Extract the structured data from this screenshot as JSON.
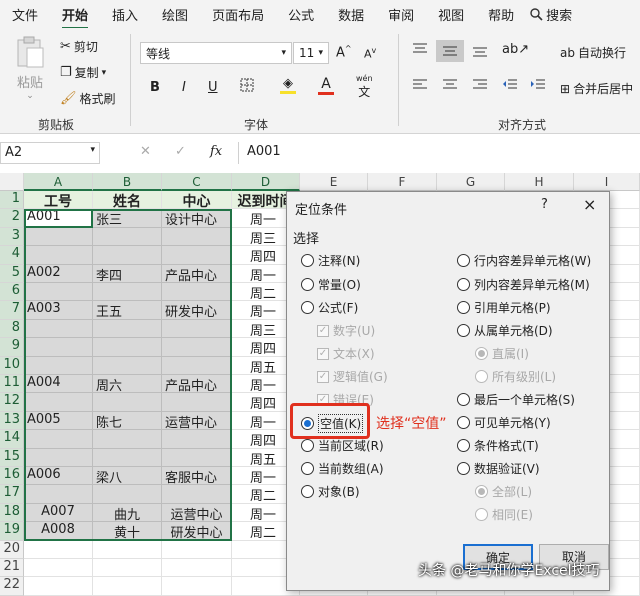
{
  "menu": {
    "items": [
      "文件",
      "开始",
      "插入",
      "绘图",
      "页面布局",
      "公式",
      "数据",
      "审阅",
      "视图",
      "帮助"
    ],
    "search_label": "搜索"
  },
  "ribbon": {
    "clipboard": {
      "paste": "粘贴",
      "cut": "剪切",
      "copy": "复制",
      "format_painter": "格式刷",
      "label": "剪贴板"
    },
    "font": {
      "name": "等线",
      "size": "11",
      "bold": "B",
      "italic": "I",
      "underline": "U",
      "label": "字体",
      "grow": "A",
      "shrink": "A",
      "wen": "wén"
    },
    "alignment": {
      "wrap": "自动换行",
      "merge": "合并后居中",
      "label": "对齐方式"
    }
  },
  "formula_bar": {
    "name_box": "A2",
    "fx": "fx",
    "value": "A001"
  },
  "columns": [
    "A",
    "B",
    "C",
    "D",
    "E",
    "F",
    "G",
    "H",
    "I"
  ],
  "rows": [
    "1",
    "2",
    "3",
    "4",
    "5",
    "6",
    "7",
    "8",
    "9",
    "10",
    "11",
    "12",
    "13",
    "14",
    "15",
    "16",
    "17",
    "18",
    "19",
    "20",
    "21",
    "22"
  ],
  "table": {
    "headers": [
      "工号",
      "姓名",
      "中心",
      "迟到时间"
    ],
    "col_a": [
      "",
      "A001",
      "",
      "",
      "A002",
      "",
      "A003",
      "",
      "",
      "",
      "A004",
      "",
      "A005",
      "",
      "",
      "A006",
      "",
      "A007",
      "A008"
    ],
    "col_b": [
      "",
      "张三",
      "",
      "",
      "李四",
      "",
      "王五",
      "",
      "",
      "",
      "周六",
      "",
      "陈七",
      "",
      "",
      "梁八",
      "",
      "曲九",
      "黄十"
    ],
    "col_c": [
      "",
      "设计中心",
      "",
      "",
      "产品中心",
      "",
      "研发中心",
      "",
      "",
      "",
      "产品中心",
      "",
      "运营中心",
      "",
      "",
      "客服中心",
      "",
      "运营中心",
      "研发中心"
    ],
    "col_d": [
      "",
      "周一",
      "周三",
      "周四",
      "周一",
      "周二",
      "周一",
      "周三",
      "周四",
      "周五",
      "周一",
      "周四",
      "周一",
      "周四",
      "周五",
      "周一",
      "周二",
      "周一",
      "周二"
    ]
  },
  "dialog": {
    "title": "定位条件",
    "help": "?",
    "close": "×",
    "section": "选择",
    "left_options": [
      "注释(N)",
      "常量(O)",
      "公式(F)",
      "数字(U)",
      "文本(X)",
      "逻辑值(G)",
      "错误(E)",
      "空值(K)",
      "当前区域(R)",
      "当前数组(A)",
      "对象(B)"
    ],
    "right_options": [
      "行内容差异单元格(W)",
      "列内容差异单元格(M)",
      "引用单元格(P)",
      "从属单元格(D)",
      "直属(I)",
      "所有级别(L)",
      "最后一个单元格(S)",
      "可见单元格(Y)",
      "条件格式(T)",
      "数据验证(V)",
      "全部(L)",
      "相同(E)"
    ],
    "ok": "确定",
    "cancel": "取消"
  },
  "annotation": "选择“空值”",
  "watermark": "头条 @老马和你学Excel技巧",
  "colors": {
    "accent": "#217346",
    "highlight": "#e0301e",
    "selection": "#d9d9d9"
  }
}
